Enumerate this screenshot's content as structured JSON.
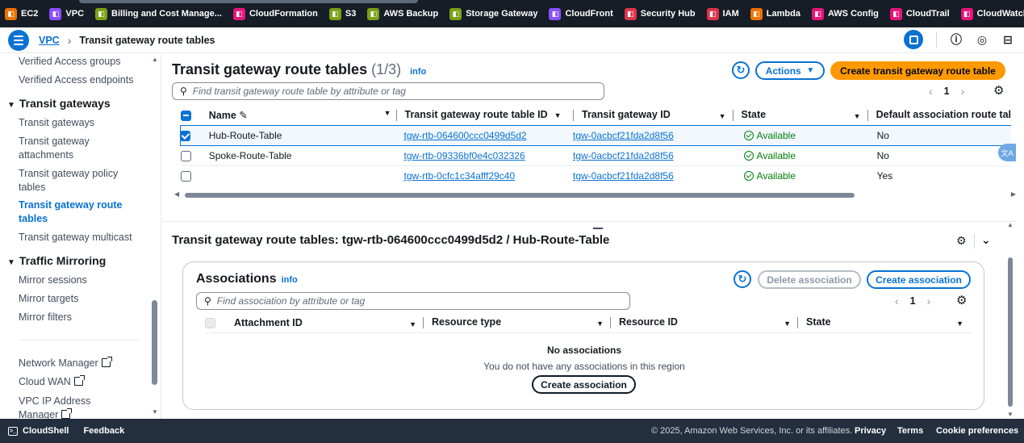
{
  "services": [
    {
      "label": "EC2",
      "icon": "ec2-icon",
      "color": "#ed7100"
    },
    {
      "label": "VPC",
      "icon": "vpc-icon",
      "color": "#8c4fff"
    },
    {
      "label": "Billing and Cost Manage...",
      "icon": "billing-icon",
      "color": "#7aa116"
    },
    {
      "label": "CloudFormation",
      "icon": "cloudformation-icon",
      "color": "#e7157b"
    },
    {
      "label": "S3",
      "icon": "s3-icon",
      "color": "#7aa116"
    },
    {
      "label": "AWS Backup",
      "icon": "backup-icon",
      "color": "#7aa116"
    },
    {
      "label": "Storage Gateway",
      "icon": "storage-gateway-icon",
      "color": "#7aa116"
    },
    {
      "label": "CloudFront",
      "icon": "cloudfront-icon",
      "color": "#8c4fff"
    },
    {
      "label": "Security Hub",
      "icon": "security-hub-icon",
      "color": "#dd344c"
    },
    {
      "label": "IAM",
      "icon": "iam-icon",
      "color": "#dd344c"
    },
    {
      "label": "Lambda",
      "icon": "lambda-icon",
      "color": "#ed7100"
    },
    {
      "label": "AWS Config",
      "icon": "config-icon",
      "color": "#e7157b"
    },
    {
      "label": "CloudTrail",
      "icon": "cloudtrail-icon",
      "color": "#e7157b"
    },
    {
      "label": "CloudWatch",
      "icon": "cloudwatch-icon",
      "color": "#e7157b"
    }
  ],
  "breadcrumb": {
    "root": "VPC",
    "current": "Transit gateway route tables"
  },
  "sidebar": {
    "items_top": [
      "Verified Access groups",
      "Verified Access endpoints"
    ],
    "section_tg": "Transit gateways",
    "tg_items": [
      "Transit gateways",
      "Transit gateway attachments",
      "Transit gateway policy tables",
      "Transit gateway route tables",
      "Transit gateway multicast"
    ],
    "section_tm": "Traffic Mirroring",
    "tm_items": [
      "Mirror sessions",
      "Mirror targets",
      "Mirror filters"
    ],
    "ext_items": [
      "Network Manager",
      "Cloud WAN",
      "VPC IP Address Manager"
    ]
  },
  "top": {
    "title": "Transit gateway route tables",
    "count": "(1/3)",
    "info": "info",
    "actions": "Actions",
    "create": "Create transit gateway route table",
    "search_placeholder": "Find transit gateway route table by attribute or tag",
    "page": "1",
    "columns": [
      "Name",
      "Transit gateway route table ID",
      "Transit gateway ID",
      "State",
      "Default association route tal"
    ],
    "rows": [
      {
        "name": "Hub-Route-Table",
        "rtb": "tgw-rtb-064600ccc0499d5d2",
        "tgw": "tgw-0acbcf21fda2d8f56",
        "state": "Available",
        "default": "No",
        "selected": true
      },
      {
        "name": "Spoke-Route-Table",
        "rtb": "tgw-rtb-09336bf0e4c032326",
        "tgw": "tgw-0acbcf21fda2d8f56",
        "state": "Available",
        "default": "No",
        "selected": false
      },
      {
        "name": "",
        "rtb": "tgw-rtb-0cfc1c34afff29c40",
        "tgw": "tgw-0acbcf21fda2d8f56",
        "state": "Available",
        "default": "Yes",
        "selected": false
      }
    ]
  },
  "detail": {
    "title": "Transit gateway route tables: tgw-rtb-064600ccc0499d5d2 / Hub-Route-Table",
    "assoc_title": "Associations",
    "info": "info",
    "delete": "Delete association",
    "create": "Create association",
    "search_placeholder": "Find association by attribute or tag",
    "page": "1",
    "columns": [
      "Attachment ID",
      "Resource type",
      "Resource ID",
      "State"
    ],
    "empty_title": "No associations",
    "empty_text": "You do not have any associations in this region",
    "empty_button": "Create association"
  },
  "footer": {
    "cloudshell": "CloudShell",
    "feedback": "Feedback",
    "copyright": "© 2025, Amazon Web Services, Inc. or its affiliates.",
    "privacy": "Privacy",
    "terms": "Terms",
    "cookies": "Cookie preferences"
  }
}
